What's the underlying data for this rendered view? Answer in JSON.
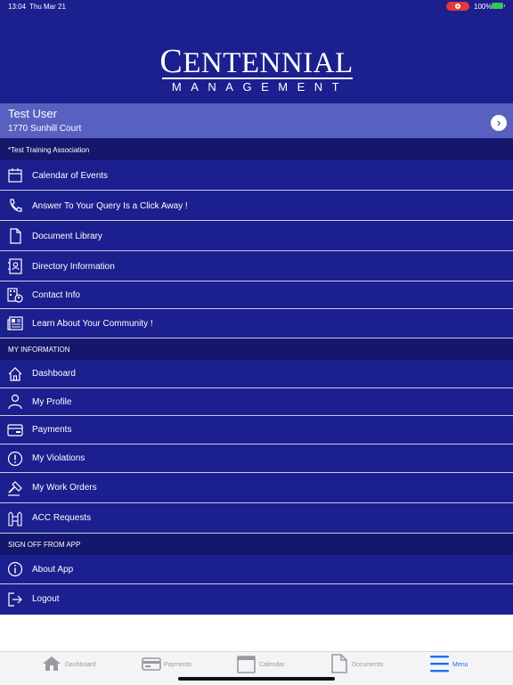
{
  "status_bar": {
    "time": "13:04",
    "date": "Thu Mar 21",
    "battery": "100%"
  },
  "logo": {
    "line1": "Centennial",
    "line2": "MANAGEMENT"
  },
  "user": {
    "name": "Test User",
    "address": "1770 Sunhill Court"
  },
  "association": "*Test Training Association",
  "menu": [
    {
      "label": "Calendar of Events",
      "icon": "calendar-icon"
    },
    {
      "label": "Answer To Your Query Is a Click Away !",
      "icon": "phone-icon"
    },
    {
      "label": "Document Library",
      "icon": "document-icon"
    },
    {
      "label": "Directory Information",
      "icon": "contact-card-icon"
    },
    {
      "label": "Contact Info",
      "icon": "building-contact-icon"
    },
    {
      "label": "Learn About Your Community !",
      "icon": "newspaper-icon"
    }
  ],
  "my_info": {
    "header": "MY INFORMATION",
    "items": [
      {
        "label": "Dashboard",
        "icon": "home-icon"
      },
      {
        "label": "My Profile",
        "icon": "person-icon"
      },
      {
        "label": "Payments",
        "icon": "payment-card-icon"
      },
      {
        "label": "My Violations",
        "icon": "alert-circle-icon"
      },
      {
        "label": "My Work Orders",
        "icon": "hammer-icon"
      },
      {
        "label": "ACC Requests",
        "icon": "fence-icon"
      }
    ]
  },
  "sign_off": {
    "header": "SIGN OFF FROM APP",
    "items": [
      {
        "label": "About App",
        "icon": "info-icon"
      },
      {
        "label": "Logout",
        "icon": "logout-icon"
      }
    ]
  },
  "tabs": [
    {
      "label": "Dashboard",
      "icon": "home-icon"
    },
    {
      "label": "Payments",
      "icon": "payment-card-icon"
    },
    {
      "label": "Calendar",
      "icon": "calendar-icon"
    },
    {
      "label": "Documents",
      "icon": "document-icon"
    },
    {
      "label": "Menu",
      "icon": "hamburger-menu-icon"
    }
  ],
  "colors": {
    "primary": "#1c1f8e",
    "section": "#14176b",
    "user_bar": "#5961c0",
    "active_tab": "#1a73e8"
  }
}
